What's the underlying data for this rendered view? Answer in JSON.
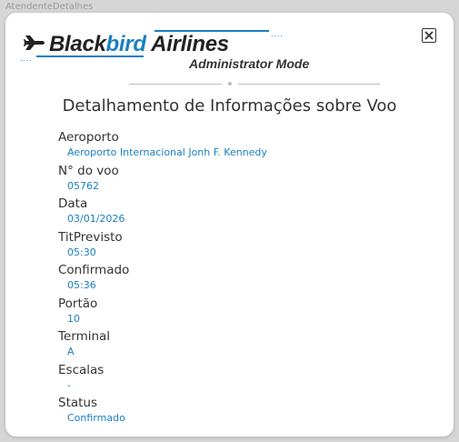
{
  "window": {
    "caption": "AtendenteDetalhes"
  },
  "logo": {
    "brand_part1": "Black",
    "brand_part2": "bird",
    "brand_part3": " Airlines",
    "mode": "Administrator Mode",
    "icon": "airplane-icon",
    "accent_color": "#1a7fc1"
  },
  "close_icon": "close-icon",
  "page_title": "Detalhamento de Informações sobre Voo",
  "fields": [
    {
      "label": "Aeroporto",
      "value": "Aeroporto Internacional Jonh F. Kennedy"
    },
    {
      "label": "N° do voo",
      "value": "05762"
    },
    {
      "label": "Data",
      "value": "03/01/2026"
    },
    {
      "label": "TitPrevisto",
      "value": "05:30"
    },
    {
      "label": "Confirmado",
      "value": "05:36"
    },
    {
      "label": "Portão",
      "value": "10"
    },
    {
      "label": "Terminal",
      "value": "A"
    },
    {
      "label": "Escalas",
      "value": "-"
    },
    {
      "label": "Status",
      "value": "Confirmado"
    }
  ]
}
